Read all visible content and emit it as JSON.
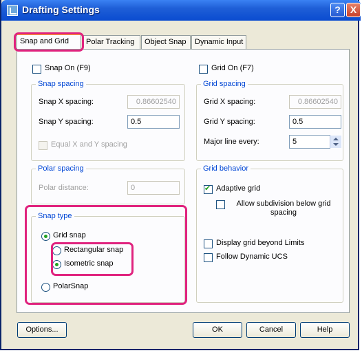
{
  "window": {
    "title": "Drafting Settings",
    "help_glyph": "?",
    "close_glyph": "X"
  },
  "tabs": [
    {
      "label": "Snap and Grid",
      "active": true
    },
    {
      "label": "Polar Tracking",
      "active": false
    },
    {
      "label": "Object Snap",
      "active": false
    },
    {
      "label": "Dynamic Input",
      "active": false
    }
  ],
  "snap": {
    "snap_on_label": "Snap On (F9)",
    "spacing_title": "Snap spacing",
    "x_label": "Snap X spacing:",
    "x_value": "0.86602540",
    "y_label": "Snap Y spacing:",
    "y_value": "0.5",
    "equal_label": "Equal X and Y spacing"
  },
  "polar": {
    "title": "Polar spacing",
    "distance_label": "Polar distance:",
    "distance_value": "0"
  },
  "snap_type": {
    "title": "Snap type",
    "grid_snap": "Grid snap",
    "rectangular": "Rectangular snap",
    "isometric": "Isometric snap",
    "polar_snap": "PolarSnap"
  },
  "grid": {
    "grid_on_label": "Grid On (F7)",
    "spacing_title": "Grid spacing",
    "x_label": "Grid X spacing:",
    "x_value": "0.86602540",
    "y_label": "Grid Y spacing:",
    "y_value": "0.5",
    "major_label": "Major line every:",
    "major_value": "5"
  },
  "grid_behavior": {
    "title": "Grid behavior",
    "adaptive": "Adaptive grid",
    "subdivision": "Allow subdivision below grid spacing",
    "beyond_limits": "Display grid beyond Limits",
    "follow_ucs": "Follow Dynamic UCS"
  },
  "buttons": {
    "options": "Options...",
    "ok": "OK",
    "cancel": "Cancel",
    "help": "Help"
  },
  "colors": {
    "highlight": "#e0237e",
    "group_title": "#0046d5",
    "titlebar": "#0a4bd0"
  }
}
